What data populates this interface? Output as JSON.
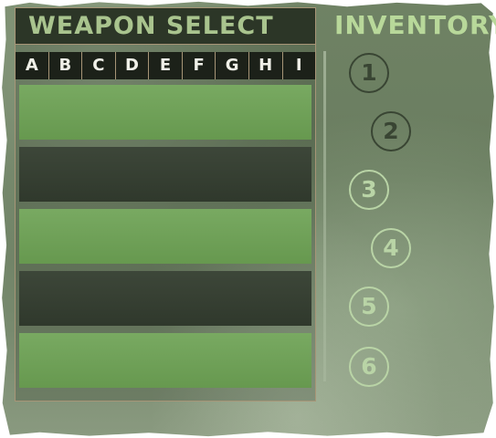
{
  "weapon_select": {
    "title": "WEAPON SELECT",
    "slots": [
      "A",
      "B",
      "C",
      "D",
      "E",
      "F",
      "G",
      "H",
      "I"
    ]
  },
  "inventory": {
    "title": "INVENTORY",
    "slots": [
      "1",
      "2",
      "3",
      "4",
      "5",
      "6"
    ]
  },
  "colors": {
    "panel_header": "#2c3627",
    "band_light": "#6da254",
    "band_dark": "#353f31",
    "title_text": "#a9c48e",
    "border": "#a79577"
  }
}
